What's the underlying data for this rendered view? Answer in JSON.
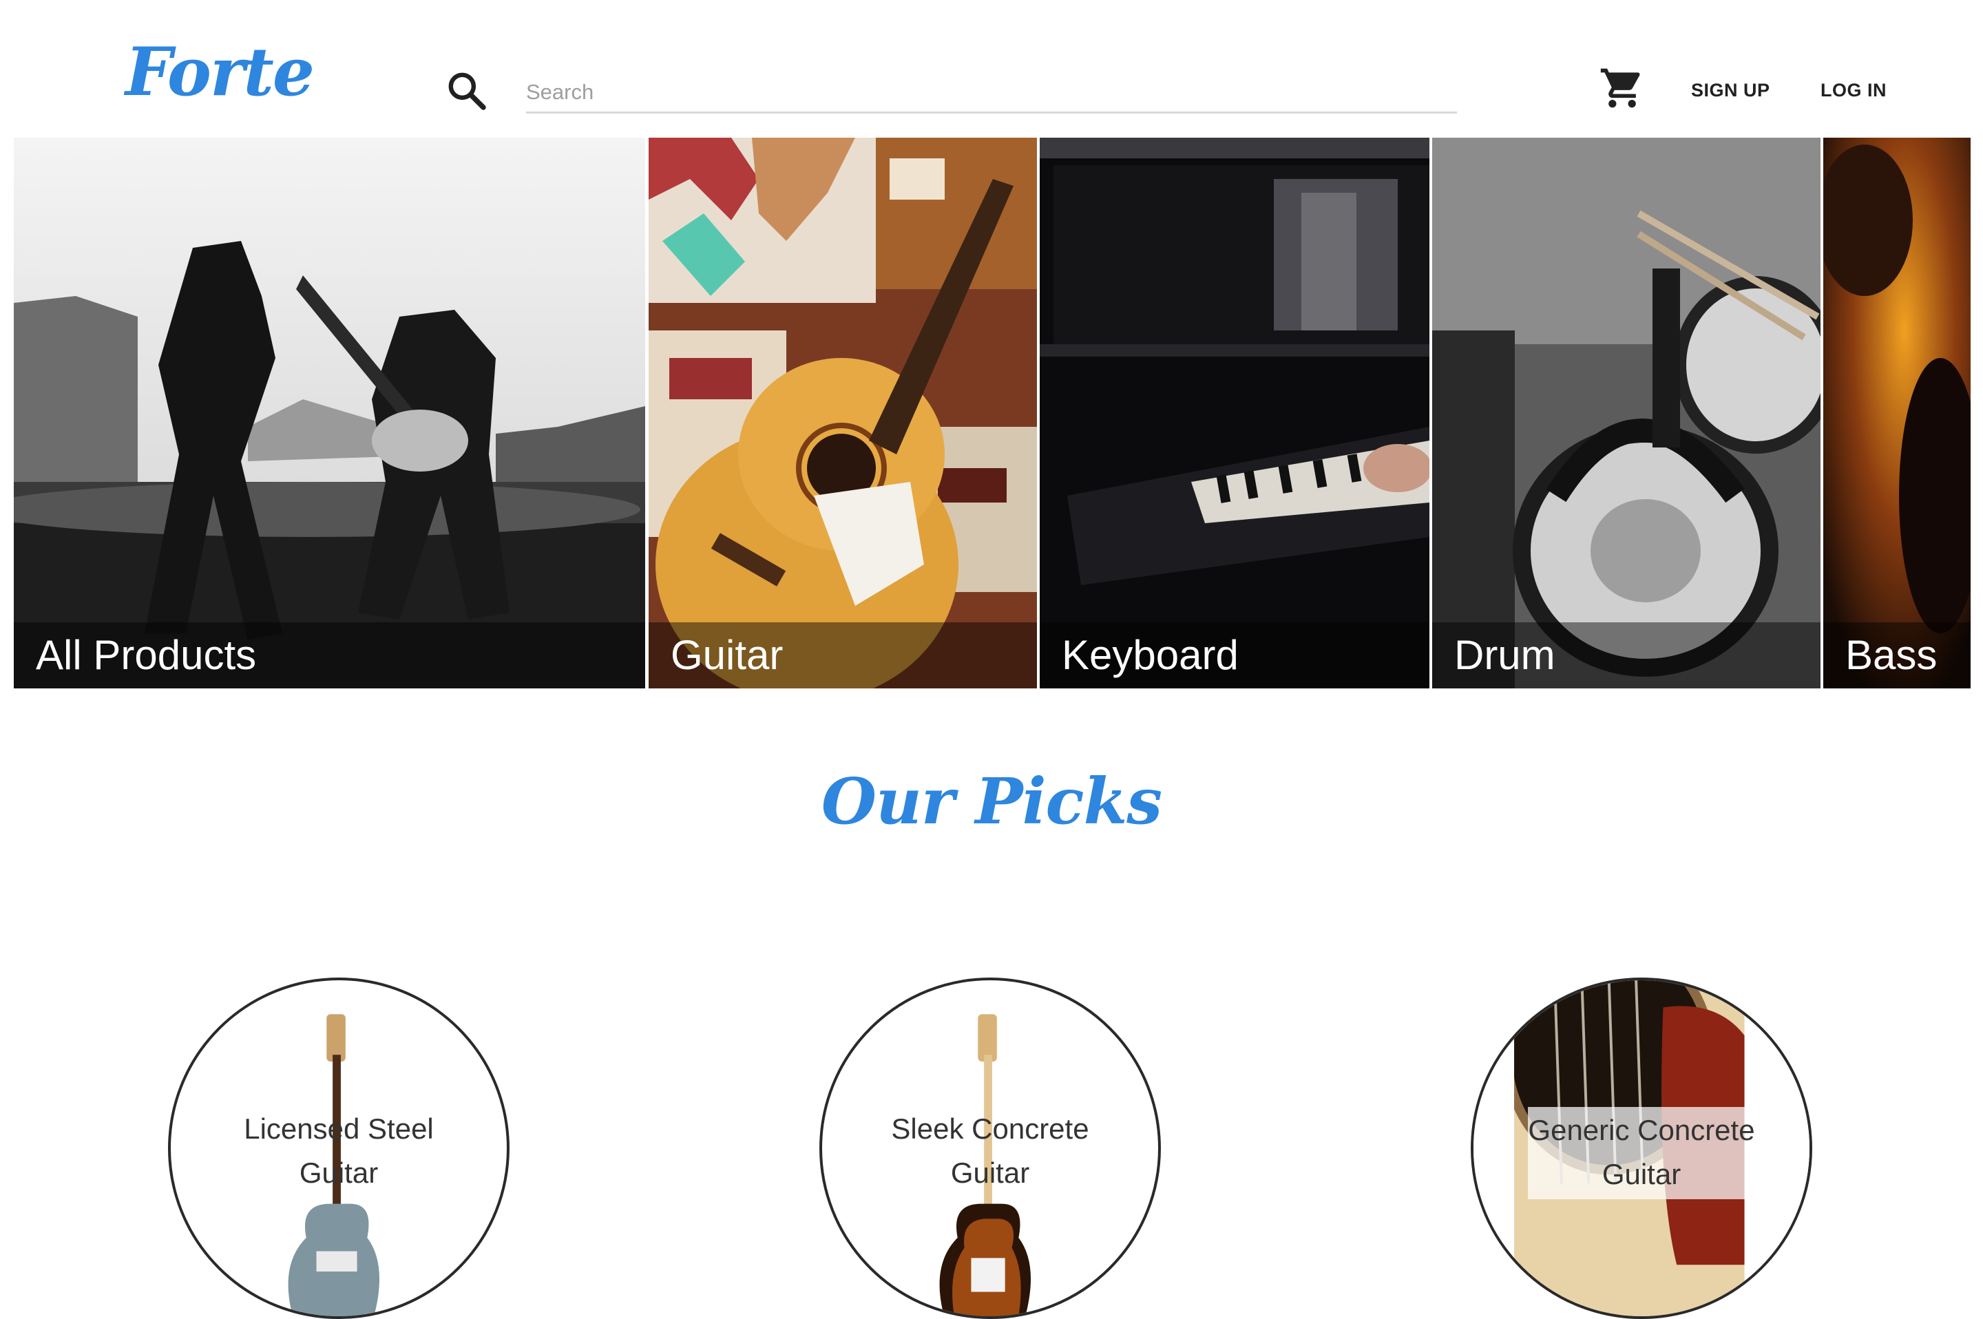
{
  "brand": {
    "logo_text": "Forte",
    "color": "#2e86de"
  },
  "header": {
    "search_icon": "search-icon",
    "search_placeholder": "Search",
    "search_value": "",
    "cart_icon": "shopping-cart-icon",
    "signup_label": "SIGN UP",
    "login_label": "LOG IN"
  },
  "categories": [
    {
      "label": "All Products",
      "image": "black-and-white concert photo of two guitarists on stage"
    },
    {
      "label": "Guitar",
      "image": "acoustic guitar on patterned rug"
    },
    {
      "label": "Keyboard",
      "image": "hands playing a piano keyboard"
    },
    {
      "label": "Drum",
      "image": "electronic drum kit with headphones and drumsticks"
    },
    {
      "label": "Bass",
      "image": "close-up of sunburst bass guitar"
    }
  ],
  "picks": {
    "title": "Our Picks",
    "items": [
      {
        "name": "Licensed Steel Guitar"
      },
      {
        "name": "Sleek Concrete Guitar"
      },
      {
        "name": "Generic Concrete Guitar"
      }
    ]
  }
}
